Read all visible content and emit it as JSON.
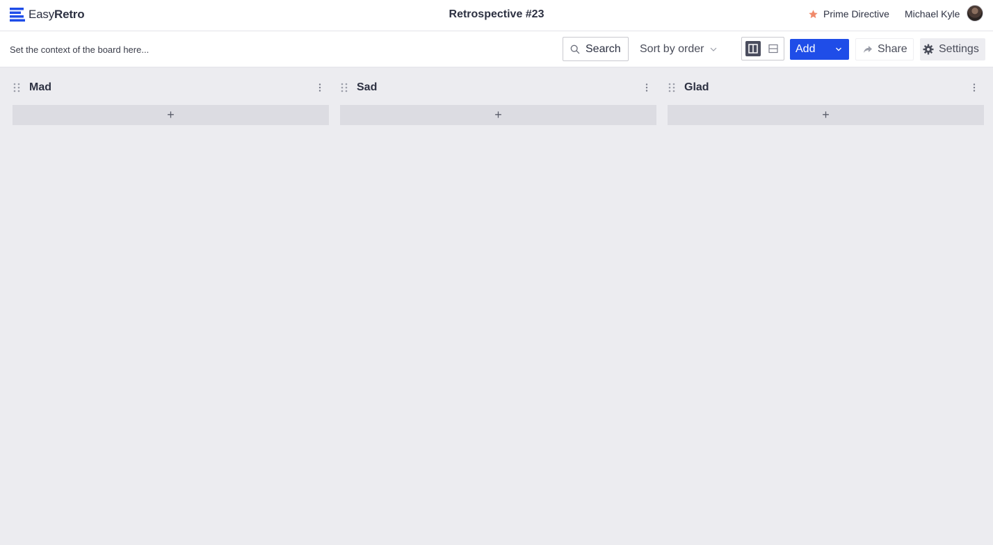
{
  "brand": {
    "part1": "Easy",
    "part2": "Retro"
  },
  "board": {
    "title": "Retrospective #23",
    "context_placeholder": "Set the context of the board here..."
  },
  "header": {
    "prime_directive": "Prime Directive",
    "user_name": "Michael Kyle"
  },
  "toolbar": {
    "search_label": "Search",
    "sort_label": "Sort by order",
    "add_label": "Add",
    "share_label": "Share",
    "settings_label": "Settings",
    "view_mode": "columns"
  },
  "columns": [
    {
      "title": "Mad",
      "add_glyph": "+"
    },
    {
      "title": "Sad",
      "add_glyph": "+"
    },
    {
      "title": "Glad",
      "add_glyph": "+"
    }
  ],
  "colors": {
    "accent": "#1f4de8",
    "star": "#f0896a",
    "background": "#ececf0",
    "text": "#2d3142"
  },
  "icons": {
    "logo": "easyretro-logo-icon",
    "star": "star-icon",
    "search": "search-icon",
    "sort": "chevron-down-icon",
    "view_columns": "columns-view-icon",
    "view_rows": "rows-view-icon",
    "add_caret": "chevron-down-icon",
    "share": "share-arrow-icon",
    "settings": "gear-icon",
    "drag": "drag-handle-icon",
    "menu": "kebab-menu-icon"
  }
}
